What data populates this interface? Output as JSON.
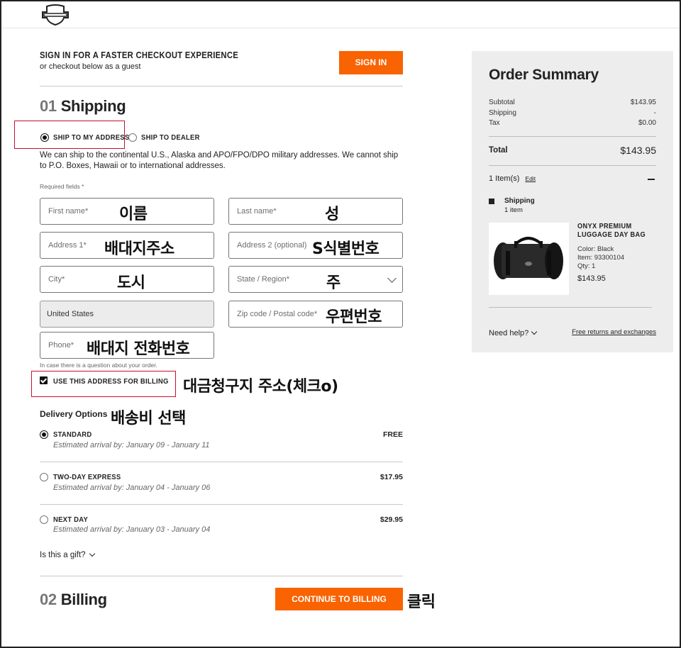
{
  "header": {
    "logo_icon": "bar-and-shield-logo-icon"
  },
  "signin": {
    "title": "SIGN IN FOR A FASTER CHECKOUT EXPERIENCE",
    "subtitle": "or checkout below as a guest",
    "button": "SIGN IN"
  },
  "shipping": {
    "num": "01",
    "title": "Shipping",
    "option_address": "SHIP TO MY ADDRESS",
    "option_dealer": "SHIP TO DEALER",
    "notice": "We can ship to the continental U.S., Alaska and APO/FPO/DPO military addresses. We cannot ship to P.O. Boxes, Hawaii or to international addresses.",
    "required": "Required fields *",
    "fields": {
      "first_name": "First name*",
      "last_name": "Last name*",
      "address1": "Address 1*",
      "address2": "Address 2 (optional)",
      "city": "City*",
      "state": "State / Region*",
      "country": "United States",
      "zip": "Zip code / Postal code*",
      "phone": "Phone*"
    },
    "phone_hint": "In case there is a question about your order.",
    "billing_checkbox": "USE THIS ADDRESS FOR BILLING"
  },
  "annotations": {
    "first_name": "이름",
    "last_name": "성",
    "address1": "배대지주소",
    "address2": "S식별번호",
    "city": "도시",
    "state": "주",
    "zip": "우편번호",
    "phone": "배대지 전화번호",
    "billing": "대금청구지 주소(체크o)",
    "delivery": "배송비 선택",
    "click": "클릭"
  },
  "delivery": {
    "title": "Delivery Options",
    "options": [
      {
        "label": "STANDARD",
        "arrival": "Estimated arrival by: January 09 - January 11",
        "price": "FREE"
      },
      {
        "label": "TWO-DAY EXPRESS",
        "arrival": "Estimated arrival by: January 04 - January 06",
        "price": "$17.95"
      },
      {
        "label": "NEXT DAY",
        "arrival": "Estimated arrival by: January 03 - January 04",
        "price": "$29.95"
      }
    ],
    "gift": "Is this a gift?"
  },
  "billing": {
    "num": "02",
    "title": "Billing",
    "continue_button": "CONTINUE TO BILLING"
  },
  "summary": {
    "title": "Order Summary",
    "subtotal_label": "Subtotal",
    "subtotal": "$143.95",
    "shipping_label": "Shipping",
    "shipping": "-",
    "tax_label": "Tax",
    "tax": "$0.00",
    "total_label": "Total",
    "total": "$143.95",
    "items": "1 Item(s)",
    "edit": "Edit",
    "ship_label": "Shipping",
    "ship_count": "1 item",
    "product": {
      "name": "ONYX PREMIUM LUGGAGE DAY BAG",
      "color": "Color: Black",
      "item": "Item: 93300104",
      "qty": "Qty: 1",
      "price": "$143.95"
    },
    "help": "Need help?",
    "returns": "Free returns and exchanges"
  },
  "colors": {
    "accent": "#f96302",
    "annotation_box": "#c8102e",
    "summary_bg": "#ededed"
  }
}
